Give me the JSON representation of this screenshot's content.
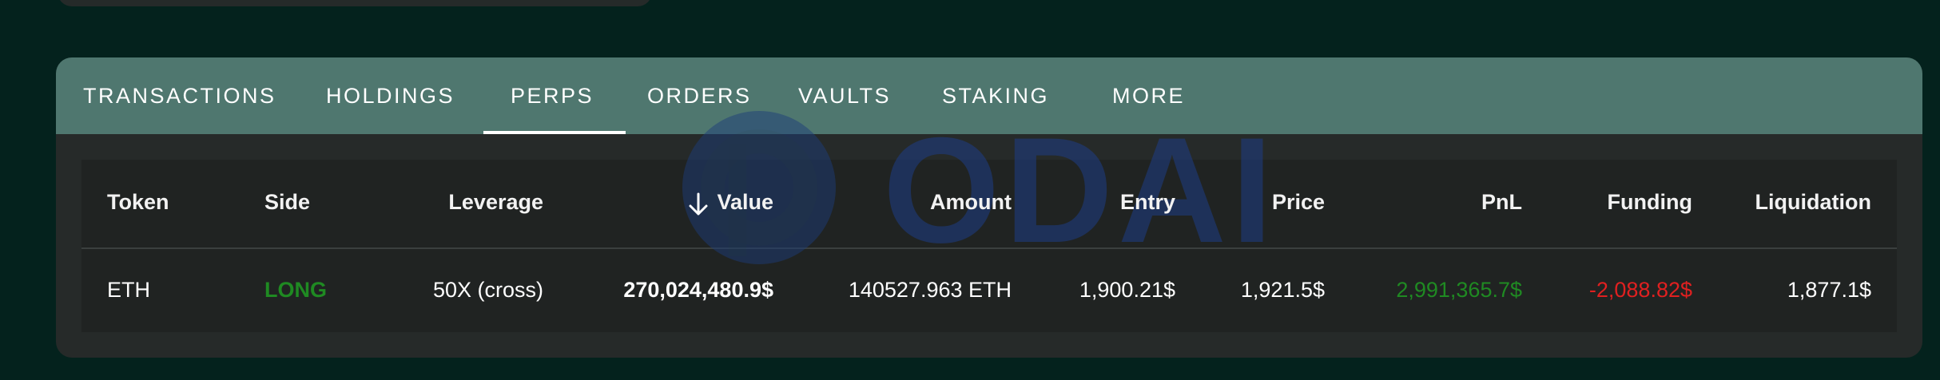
{
  "tabs": [
    {
      "label": "TRANSACTIONS",
      "active": false
    },
    {
      "label": "HOLDINGS",
      "active": false
    },
    {
      "label": "PERPS",
      "active": true
    },
    {
      "label": "ORDERS",
      "active": false
    },
    {
      "label": "VAULTS",
      "active": false
    },
    {
      "label": "STAKING",
      "active": false
    },
    {
      "label": "MORE",
      "active": false
    }
  ],
  "table": {
    "headers": [
      "Token",
      "Side",
      "Leverage",
      "Value",
      "Amount",
      "Entry",
      "Price",
      "PnL",
      "Funding",
      "Liquidation"
    ],
    "sort_column": "Value",
    "sort_direction": "descending",
    "rows": [
      {
        "token": "ETH",
        "side": "LONG",
        "leverage": "50X (cross)",
        "value": "270,024,480.9$",
        "amount": "140527.963 ETH",
        "entry": "1,900.21$",
        "price": "1,921.5$",
        "pnl": "2,991,365.7$",
        "funding": "-2,088.82$",
        "liquidation": "1,877.1$"
      }
    ]
  },
  "watermark": {
    "text": "ODAILY"
  },
  "colors": {
    "background": "#04221d",
    "tabbar": "#4f776f",
    "panel": "#262a29",
    "long": "#1f8a22",
    "pnl_positive": "#1f8a22",
    "funding_negative": "#e02020"
  }
}
